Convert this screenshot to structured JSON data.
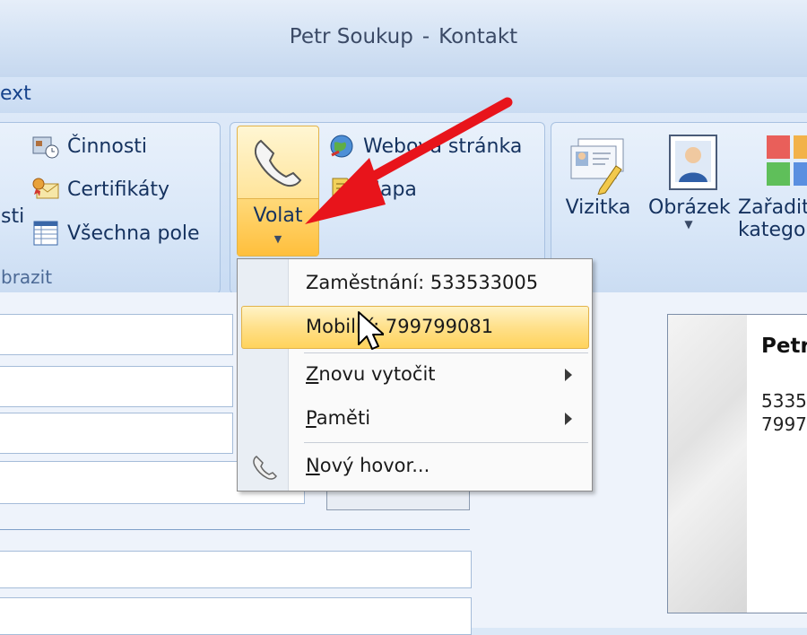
{
  "window": {
    "title_name": "Petr Soukup",
    "title_sep": "-",
    "title_app": "Kontakt"
  },
  "tab": {
    "partial_label": "ext"
  },
  "show_group": {
    "label": "brazit",
    "partial_left": "sti",
    "items": [
      {
        "label": "Činnosti",
        "icon": "activities-icon"
      },
      {
        "label": "Certifikáty",
        "icon": "certificate-icon"
      },
      {
        "label": "Všechna pole",
        "icon": "all-fields-icon"
      }
    ]
  },
  "communicate_group": {
    "call_label": "Volat",
    "web_label": "Webová stránka",
    "map_label": "Mapa"
  },
  "options_group": {
    "card_label": "Vizitka",
    "picture_label": "Obrázek",
    "categorize_label_1": "Zařadit",
    "categorize_label_2": "kategor"
  },
  "call_menu": {
    "items": [
      {
        "label": "Zaměstnání: 533533005",
        "highlighted": false
      },
      {
        "label": "Mobilní: 799799081",
        "highlighted": true
      }
    ],
    "redial_prefix": "Z",
    "redial_rest": "novu vytočit",
    "memory_prefix": "P",
    "memory_rest": "aměti",
    "new_call_prefix": "N",
    "new_call_rest": "ový hovor..."
  },
  "business_card": {
    "name_partial": "Petr",
    "phone1_partial": "5335",
    "phone2_partial": "7997"
  },
  "colors": {
    "highlight": "#ffd35c",
    "arrow": "#e8141b",
    "ribbon": "#dbe8f7"
  }
}
